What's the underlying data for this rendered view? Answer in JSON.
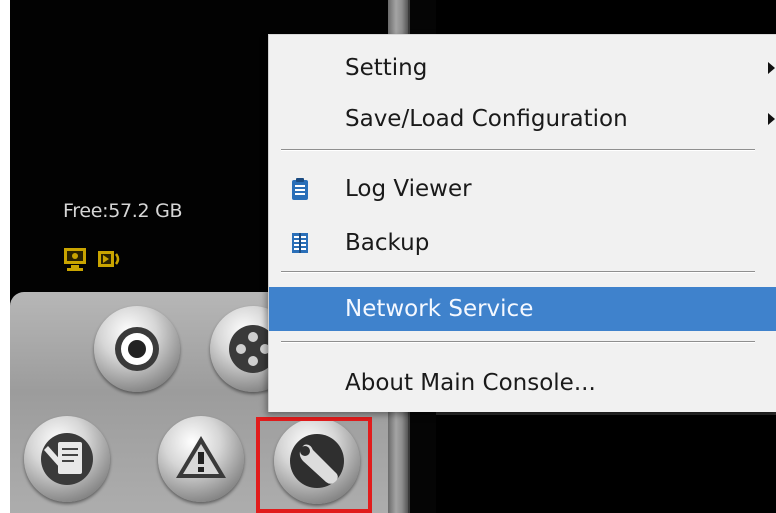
{
  "storage": {
    "free_space": "Free:57.2 GB"
  },
  "status_icons": [
    {
      "name": "monitor-icon",
      "color": "#c9a400"
    },
    {
      "name": "playback-icon",
      "color": "#c9a400"
    }
  ],
  "context_menu": {
    "items": [
      {
        "label": "Setting",
        "has_submenu": true
      },
      {
        "label": "Save/Load Configuration",
        "has_submenu": true
      },
      {
        "label": "Log Viewer",
        "icon": "clipboard-icon"
      },
      {
        "label": "Backup",
        "icon": "backup-icon"
      },
      {
        "label": "Network Service",
        "selected": true
      },
      {
        "label": "About Main Console..."
      }
    ],
    "selected_color": "#3f82cc"
  },
  "toolbar_buttons": [
    {
      "name": "record-button",
      "icon": "record-icon"
    },
    {
      "name": "film-button",
      "icon": "film-reel-icon"
    },
    {
      "name": "notes-button",
      "icon": "notes-icon"
    },
    {
      "name": "alarm-button",
      "icon": "warning-icon"
    },
    {
      "name": "tools-button",
      "icon": "wrench-icon"
    }
  ],
  "highlight": {
    "target": "tools-button",
    "color": "#e11c1c"
  }
}
